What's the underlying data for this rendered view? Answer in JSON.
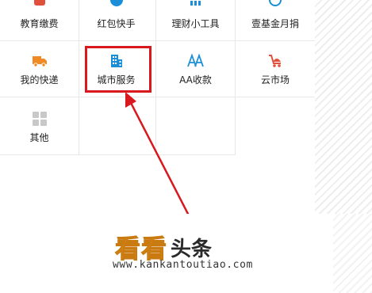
{
  "grid": {
    "items": [
      {
        "label": "教育缴费",
        "icon": "education-icon"
      },
      {
        "label": "红包快手",
        "icon": "red-packet-icon"
      },
      {
        "label": "理财小工具",
        "icon": "finance-tool-icon"
      },
      {
        "label": "壹基金月捐",
        "icon": "charity-icon"
      },
      {
        "label": "我的快递",
        "icon": "delivery-truck-icon"
      },
      {
        "label": "城市服务",
        "icon": "city-building-icon"
      },
      {
        "label": "AA收款",
        "icon": "aa-collect-icon"
      },
      {
        "label": "云市场",
        "icon": "cloud-market-icon"
      },
      {
        "label": "其他",
        "icon": "other-apps-icon"
      }
    ],
    "highlighted_item": "城市服务"
  },
  "colors": {
    "highlight": "#d9181e",
    "arrow": "#d9181e",
    "orange_icon": "#f08a24",
    "blue_icon": "#1a8fd8",
    "red_icon": "#e0503c",
    "gray_icon": "#c8c8c8"
  },
  "watermark": {
    "logo_big": "看看",
    "logo_small": "头条",
    "url": "www.kankantoutiao.com"
  }
}
